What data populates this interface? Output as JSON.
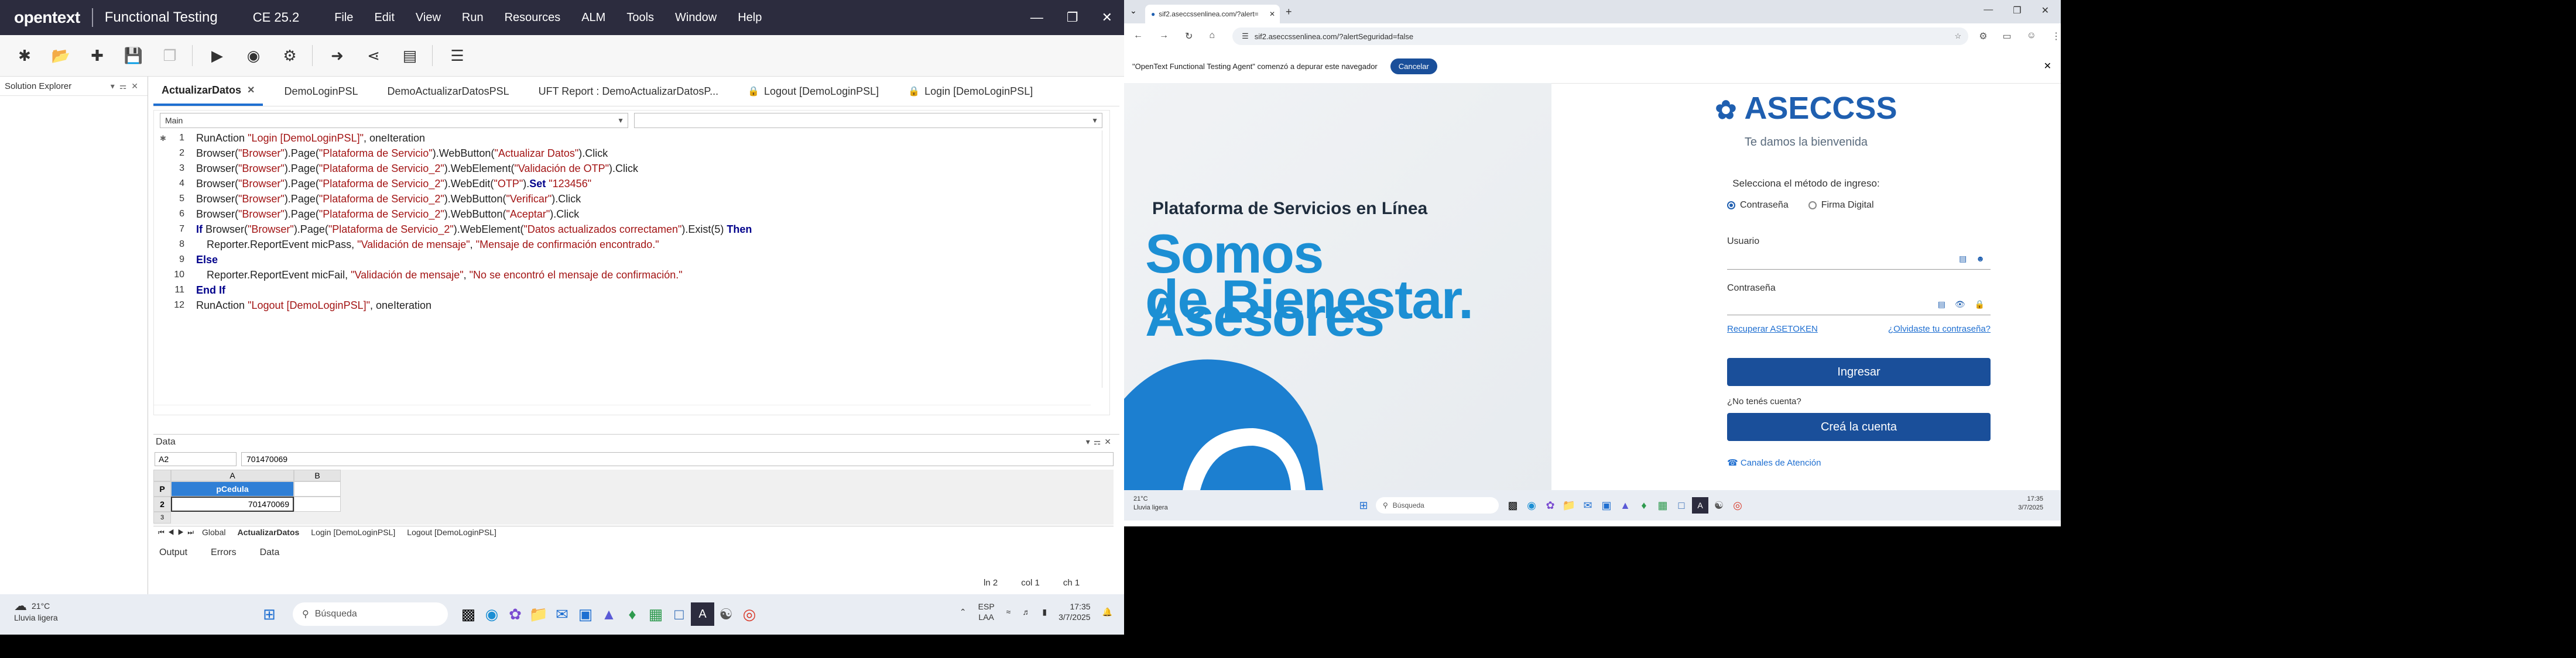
{
  "uft": {
    "logo": "opentext",
    "app_name": "Functional Testing",
    "version": "CE 25.2",
    "menu": [
      "File",
      "Edit",
      "View",
      "Run",
      "Resources",
      "ALM",
      "Tools",
      "Window",
      "Help"
    ],
    "solution_explorer": "Solution Explorer",
    "tabs": [
      {
        "label": "ActualizarDatos",
        "active": true,
        "closable": true,
        "locked": false
      },
      {
        "label": "DemoLoginPSL",
        "active": false,
        "closable": false,
        "locked": false
      },
      {
        "label": "DemoActualizarDatosPSL",
        "active": false,
        "closable": false,
        "locked": false
      },
      {
        "label": "UFT Report : DemoActualizarDatosP...",
        "active": false,
        "closable": false,
        "locked": false
      },
      {
        "label": "Logout [DemoLoginPSL]",
        "active": false,
        "closable": false,
        "locked": true
      },
      {
        "label": "Login [DemoLoginPSL]",
        "active": false,
        "closable": false,
        "locked": true
      }
    ],
    "scope_selector": "Main",
    "code_lines": [
      {
        "n": "1",
        "indent": 0,
        "parts": [
          [
            "t",
            "RunAction "
          ],
          [
            "s",
            "\"Login [DemoLoginPSL]\""
          ],
          [
            "t",
            ", oneIteration"
          ]
        ]
      },
      {
        "n": "2",
        "indent": 0,
        "parts": [
          [
            "t",
            "Browser("
          ],
          [
            "s",
            "\"Browser\""
          ],
          [
            "t",
            ").Page("
          ],
          [
            "s",
            "\"Plataforma de Servicio\""
          ],
          [
            "t",
            ").WebButton("
          ],
          [
            "s",
            "\"Actualizar Datos\""
          ],
          [
            "t",
            ").Click"
          ]
        ]
      },
      {
        "n": "3",
        "indent": 0,
        "parts": [
          [
            "t",
            "Browser("
          ],
          [
            "s",
            "\"Browser\""
          ],
          [
            "t",
            ").Page("
          ],
          [
            "s",
            "\"Plataforma de Servicio_2\""
          ],
          [
            "t",
            ").WebElement("
          ],
          [
            "s",
            "\"Validación de OTP\""
          ],
          [
            "t",
            ").Click"
          ]
        ]
      },
      {
        "n": "4",
        "indent": 0,
        "parts": [
          [
            "t",
            "Browser("
          ],
          [
            "s",
            "\"Browser\""
          ],
          [
            "t",
            ").Page("
          ],
          [
            "s",
            "\"Plataforma de Servicio_2\""
          ],
          [
            "t",
            ").WebEdit("
          ],
          [
            "s",
            "\"OTP\""
          ],
          [
            "t",
            ")."
          ],
          [
            "k",
            "Set"
          ],
          [
            "t",
            " "
          ],
          [
            "s",
            "\"123456\""
          ]
        ]
      },
      {
        "n": "5",
        "indent": 0,
        "parts": [
          [
            "t",
            "Browser("
          ],
          [
            "s",
            "\"Browser\""
          ],
          [
            "t",
            ").Page("
          ],
          [
            "s",
            "\"Plataforma de Servicio_2\""
          ],
          [
            "t",
            ").WebButton("
          ],
          [
            "s",
            "\"Verificar\""
          ],
          [
            "t",
            ").Click"
          ]
        ]
      },
      {
        "n": "6",
        "indent": 0,
        "parts": [
          [
            "t",
            "Browser("
          ],
          [
            "s",
            "\"Browser\""
          ],
          [
            "t",
            ").Page("
          ],
          [
            "s",
            "\"Plataforma de Servicio_2\""
          ],
          [
            "t",
            ").WebButton("
          ],
          [
            "s",
            "\"Aceptar\""
          ],
          [
            "t",
            ").Click"
          ]
        ]
      },
      {
        "n": "7",
        "indent": 0,
        "parts": [
          [
            "k",
            "If"
          ],
          [
            "t",
            " Browser("
          ],
          [
            "s",
            "\"Browser\""
          ],
          [
            "t",
            ").Page("
          ],
          [
            "s",
            "\"Plataforma de Servicio_2\""
          ],
          [
            "t",
            ").WebElement("
          ],
          [
            "s",
            "\"Datos actualizados correctamen\""
          ],
          [
            "t",
            ").Exist(5) "
          ],
          [
            "k",
            "Then"
          ]
        ]
      },
      {
        "n": "8",
        "indent": 1,
        "parts": [
          [
            "t",
            "Reporter.ReportEvent micPass, "
          ],
          [
            "s",
            "\"Validación de mensaje\""
          ],
          [
            "t",
            ", "
          ],
          [
            "s",
            "\"Mensaje de confirmación encontrado.\""
          ]
        ]
      },
      {
        "n": "9",
        "indent": 0,
        "parts": [
          [
            "k",
            "Else"
          ]
        ]
      },
      {
        "n": "10",
        "indent": 1,
        "parts": [
          [
            "t",
            "Reporter.ReportEvent micFail, "
          ],
          [
            "s",
            "\"Validación de mensaje\""
          ],
          [
            "t",
            ", "
          ],
          [
            "s",
            "\"No se encontró el mensaje de confirmación.\""
          ]
        ]
      },
      {
        "n": "11",
        "indent": 0,
        "parts": [
          [
            "k",
            "End If"
          ]
        ]
      },
      {
        "n": "12",
        "indent": 0,
        "parts": [
          [
            "t",
            "RunAction "
          ],
          [
            "s",
            "\"Logout [DemoLoginPSL]\""
          ],
          [
            "t",
            ", oneIteration"
          ]
        ]
      }
    ],
    "data_pane": {
      "title": "Data",
      "cell_ref": "A2",
      "cell_value": "701470069",
      "col_a": "A",
      "col_b": "B",
      "row_header": "P",
      "param_name": "pCedula",
      "row2": "2",
      "row3": "3",
      "value": "701470069",
      "sheets": [
        "Global",
        "ActualizarDatos",
        "Login [DemoLoginPSL]",
        "Logout [DemoLoginPSL]"
      ]
    },
    "bottom_tabs": [
      "Output",
      "Errors",
      "Data"
    ],
    "status": {
      "ln": "ln 2",
      "col": "col 1",
      "ch": "ch 1"
    },
    "taskbar": {
      "temp": "21°C",
      "weather": "Lluvia ligera",
      "search": "Búsqueda",
      "lang1": "ESP",
      "lang2": "LAA",
      "time": "17:35",
      "date": "3/7/2025"
    }
  },
  "browser": {
    "tab_title": "sif2.aseccssenlinea.com/?alert=",
    "url": "sif2.aseccssenlinea.com/?alertSeguridad=false",
    "infobar_msg": "\"OpenText Functional Testing Agent\" comenzó a depurar este navegador",
    "infobar_cancel": "Cancelar",
    "hero_title": "Plataforma de Servicios en Línea",
    "hero_line1": "Somos Asesores",
    "hero_line2": "de Bienestar.",
    "logo": "ASECCSS",
    "welcome": "Te damos la bienvenida",
    "method_prompt": "Selecciona el método de ingreso:",
    "method_password": "Contraseña",
    "method_signature": "Firma Digital",
    "user_label": "Usuario",
    "password_label": "Contraseña",
    "recover_token": "Recuperar ASETOKEN",
    "forgot_password": "¿Olvidaste tu contraseña?",
    "login_button": "Ingresar",
    "no_account": "¿No tenés cuenta?",
    "create_account": "Creá la cuenta",
    "channels": "Canales de Atención",
    "taskbar": {
      "temp": "21°C",
      "weather": "Lluvia ligera",
      "search": "Búsqueda",
      "time": "17:35",
      "date": "3/7/2025"
    }
  },
  "colors": {
    "uft_titlebar": "#2c2c3e",
    "accent_blue": "#1f6fd1",
    "brand_blue": "#1a4f9a",
    "hero_blue": "#1c8fd4"
  }
}
